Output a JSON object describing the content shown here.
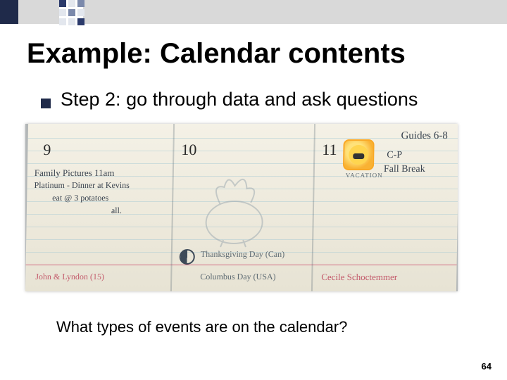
{
  "accent_dark": "#1f2a4a",
  "accent_grey": "#d9d9d9",
  "title": "Example: Calendar contents",
  "bullet": "Step 2: go through data and ask questions",
  "calendar": {
    "header_note_right": "Guides  6-8",
    "days": {
      "d9": "9",
      "d10": "10",
      "d11": "11"
    },
    "col9": {
      "line1": "Family Pictures   11am",
      "line2": "Platinum  - Dinner at Kevins",
      "line3": "eat @ 3  potatoes",
      "line4": "all.",
      "bottom": "John & Lyndon (15)"
    },
    "col10": {
      "bottom1": "Thanksgiving Day (Can)",
      "bottom2": "Columbus Day (USA)"
    },
    "col11": {
      "sticker_sub": "VACATION",
      "note1": "C-P",
      "note2": "Fall Break",
      "bottom": "Cecile  Schoctemmer"
    }
  },
  "question": "What types of events are on the calendar?",
  "page_number": "64"
}
